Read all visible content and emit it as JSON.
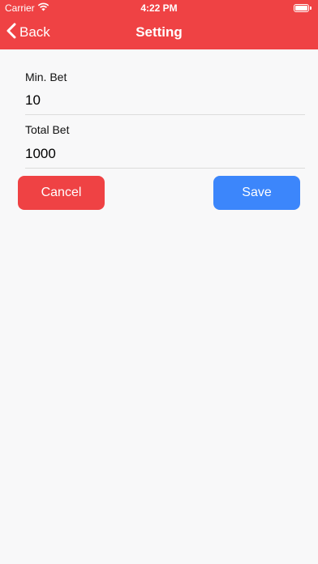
{
  "status_bar": {
    "carrier": "Carrier",
    "time": "4:22 PM"
  },
  "nav": {
    "back_label": "Back",
    "title": "Setting"
  },
  "form": {
    "min_bet": {
      "label": "Min. Bet",
      "value": "10"
    },
    "total_bet": {
      "label": "Total Bet",
      "value": "1000"
    }
  },
  "buttons": {
    "cancel_label": "Cancel",
    "save_label": "Save"
  },
  "colors": {
    "header": "#ef4244",
    "cancel": "#ef4244",
    "save": "#3c86fb",
    "background": "#f8f8f9"
  }
}
